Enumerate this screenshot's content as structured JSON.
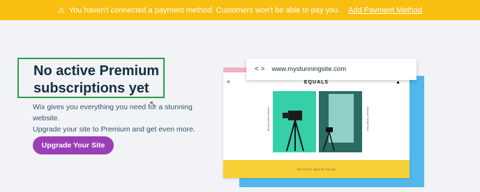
{
  "banner": {
    "icon": "warning-triangle-icon",
    "message": "You haven't connected a payment method. Customers won't be able to pay you.",
    "link_label": "Add Payment Method"
  },
  "main": {
    "title_line1": "No active Premium",
    "title_line2": "subscriptions yet",
    "description_line1": "Wix gives you everything you need for a stunning website.",
    "description_line2": "Upgrade your site to Premium and get even more.",
    "cta_label": "Upgrade Your Site"
  },
  "preview": {
    "url": "www.mystunningsite.com",
    "site_name": "EQUALS",
    "footer_text": "HOTTEST MOVIE PICKS",
    "left_caption": "Browse Action Movies",
    "right_caption": "Discover Family Films"
  },
  "colors": {
    "banner": "#f8bf12",
    "cta": "#9b3fb8",
    "highlight_border": "#2b9b4a",
    "preview_back": "#50b8ec",
    "preview_footer": "#f7cf36"
  }
}
